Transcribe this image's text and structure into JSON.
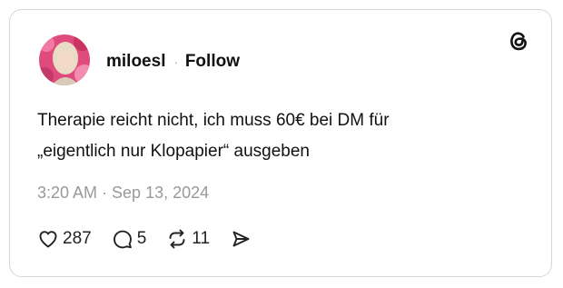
{
  "post": {
    "author": {
      "username": "miloesl",
      "separator": "·",
      "follow_label": "Follow",
      "avatar_icon": "avatar-photo"
    },
    "brand_icon": "threads-logo-icon",
    "text_lines": [
      "Therapie reicht nicht, ich muss 60€ bei DM für",
      "„eigentlich nur Klopapier“ ausgeben"
    ],
    "timestamp": "3:20 AM · Sep 13, 2024",
    "actions": {
      "like": {
        "icon": "heart-icon",
        "count": "287"
      },
      "reply": {
        "icon": "comment-icon",
        "count": "5"
      },
      "repost": {
        "icon": "repost-icon",
        "count": "11"
      },
      "share": {
        "icon": "send-icon"
      }
    }
  },
  "colors": {
    "text": "#111111",
    "muted": "#999999",
    "border": "#d6d6d6"
  }
}
